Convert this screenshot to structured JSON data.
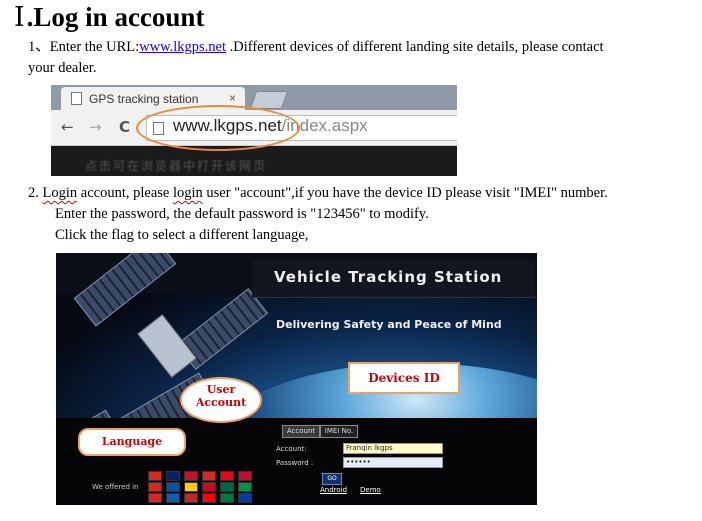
{
  "heading": {
    "roman": "Ⅰ",
    "title": ".Log in account"
  },
  "step1": {
    "prefix": "1、Enter the URL:",
    "url": "www.lkgps.net",
    "rest": " .Different devices of different landing site details, please contact",
    "line2": "your dealer."
  },
  "browser": {
    "tab_title": "GPS tracking station",
    "tab_close": "×",
    "back": "←",
    "forward": "→",
    "reload": "C",
    "address_main": "www.lkgps.net",
    "address_path": "/index.aspx",
    "blurred_text": "点击可在浏览器中打开该网页"
  },
  "step2": {
    "num": "2. ",
    "w1": "Login",
    "mid": " account, please ",
    "w2": "login",
    "rest": " user \"account\",if you have the device ID please visit \"IMEI\" number.",
    "line2": "Enter the password, the default password is \"123456\" to modify.",
    "line3": "Click the flag to select a different language,"
  },
  "vts": {
    "title": "Vehicle Tracking Station",
    "tagline": "Delivering Safety and Peace of Mind",
    "tab_account": "Account",
    "tab_imei": "IMEI No.",
    "account_label": "Account:",
    "account_value": "Franqin lkgps",
    "password_label": "Password :",
    "password_value": "••••••",
    "go": "GO",
    "android": "Android",
    "demo": "Demo",
    "offered": "We offered in",
    "callout_devices": "Devices ID",
    "callout_user_line1": "User",
    "callout_user_line2": "Account",
    "callout_language": "Language",
    "flag_colors": [
      "#d52b1e",
      "#012169",
      "#c8102e",
      "#d62828",
      "#e30a17",
      "#c60c30",
      "#da291c",
      "#0055a4",
      "#ffce00",
      "#c60b1e",
      "#006847",
      "#009246",
      "#d52b1e",
      "#0d5eaf",
      "#c1272d",
      "#ff0000",
      "#007a3d",
      "#003da5"
    ]
  }
}
